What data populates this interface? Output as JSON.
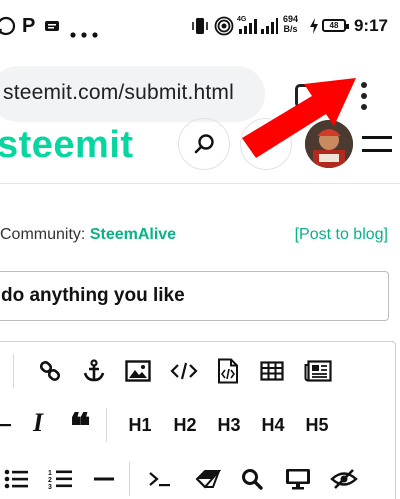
{
  "status_bar": {
    "left_icons": [
      "whatsapp-icon",
      "p-app-icon",
      "message-icon",
      "more-dots-icon"
    ],
    "network_speed_value": "694",
    "network_speed_unit": "B/s",
    "battery": "48",
    "time": "9:17"
  },
  "browser": {
    "url": "steemit.com/submit.html"
  },
  "header": {
    "logo": "steemit"
  },
  "form": {
    "community_label": "Community:",
    "community_name": "SteemAlive",
    "post_to_blog": "[Post to blog]",
    "title_value": "do anything you like"
  },
  "toolbar": {
    "headings": [
      "H1",
      "H2",
      "H3",
      "H4",
      "H5"
    ],
    "italic": "I",
    "quote": "❝"
  },
  "colors": {
    "brand": "#07d6a0",
    "link": "#07b386",
    "arrow": "#ff0000"
  }
}
